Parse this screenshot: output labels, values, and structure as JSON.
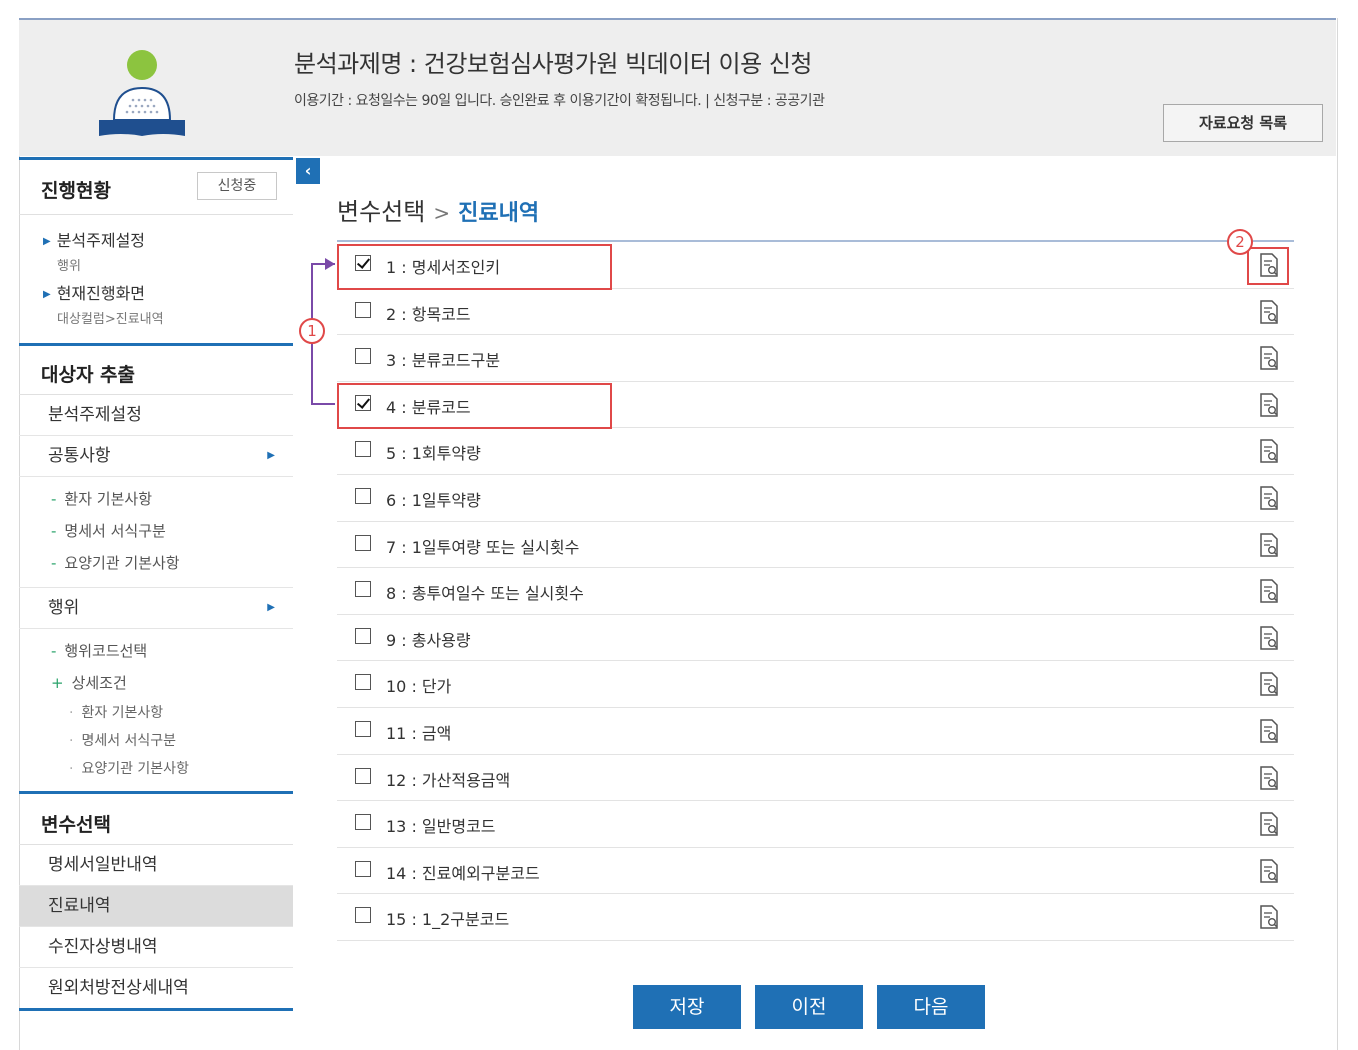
{
  "header": {
    "title": "분석과제명 : 건강보험심사평가원 빅데이터 이용 신청",
    "subtitle": "이용기간 : 요청일수는 90일 입니다. 승인완료 후 이용기간이 확정됩니다.  |  신청구분 : 공공기관",
    "list_button": "자료요청 목록"
  },
  "sidebar": {
    "progress": {
      "heading": "진행현황",
      "badge": "신청중",
      "items": [
        {
          "label": "분석주제설정",
          "sub": "행위"
        },
        {
          "label": "현재진행화면",
          "sub": "대상컬럼>진료내역"
        }
      ]
    },
    "extract": {
      "heading": "대상자 추출",
      "topic": "분석주제설정",
      "common": "공통사항",
      "common_items": [
        "환자 기본사항",
        "명세서 서식구분",
        "요양기관 기본사항"
      ],
      "act": "행위",
      "act_code": "행위코드선택",
      "detail": "상세조건",
      "detail_items": [
        "환자 기본사항",
        "명세서 서식구분",
        "요양기관 기본사항"
      ]
    },
    "variables": {
      "heading": "변수선택",
      "items": [
        "명세서일반내역",
        "진료내역",
        "수진자상병내역",
        "원외처방전상세내역"
      ],
      "active_index": 1
    }
  },
  "main": {
    "breadcrumb_root": "변수선택",
    "breadcrumb_sep": ">",
    "breadcrumb_current": "진료내역",
    "variables": [
      {
        "label": "1 : 명세서조인키",
        "checked": true
      },
      {
        "label": "2 : 항목코드",
        "checked": false
      },
      {
        "label": "3 : 분류코드구분",
        "checked": false
      },
      {
        "label": "4 : 분류코드",
        "checked": true
      },
      {
        "label": "5 : 1회투약량",
        "checked": false
      },
      {
        "label": "6 : 1일투약량",
        "checked": false
      },
      {
        "label": "7 : 1일투여량 또는 실시횟수",
        "checked": false
      },
      {
        "label": "8 : 총투여일수 또는 실시횟수",
        "checked": false
      },
      {
        "label": "9 : 총사용량",
        "checked": false
      },
      {
        "label": "10 : 단가",
        "checked": false
      },
      {
        "label": "11 : 금액",
        "checked": false
      },
      {
        "label": "12 : 가산적용금액",
        "checked": false
      },
      {
        "label": "13 : 일반명코드",
        "checked": false
      },
      {
        "label": "14 : 진료예외구분코드",
        "checked": false
      },
      {
        "label": "15 : 1_2구분코드",
        "checked": false
      }
    ]
  },
  "annotations": {
    "marker_1": "1",
    "marker_2": "2"
  },
  "buttons": {
    "save": "저장",
    "prev": "이전",
    "next": "다음"
  },
  "colors": {
    "accent": "#1f70b5",
    "highlight": "#e04848",
    "bracket": "#7a4aa8"
  }
}
